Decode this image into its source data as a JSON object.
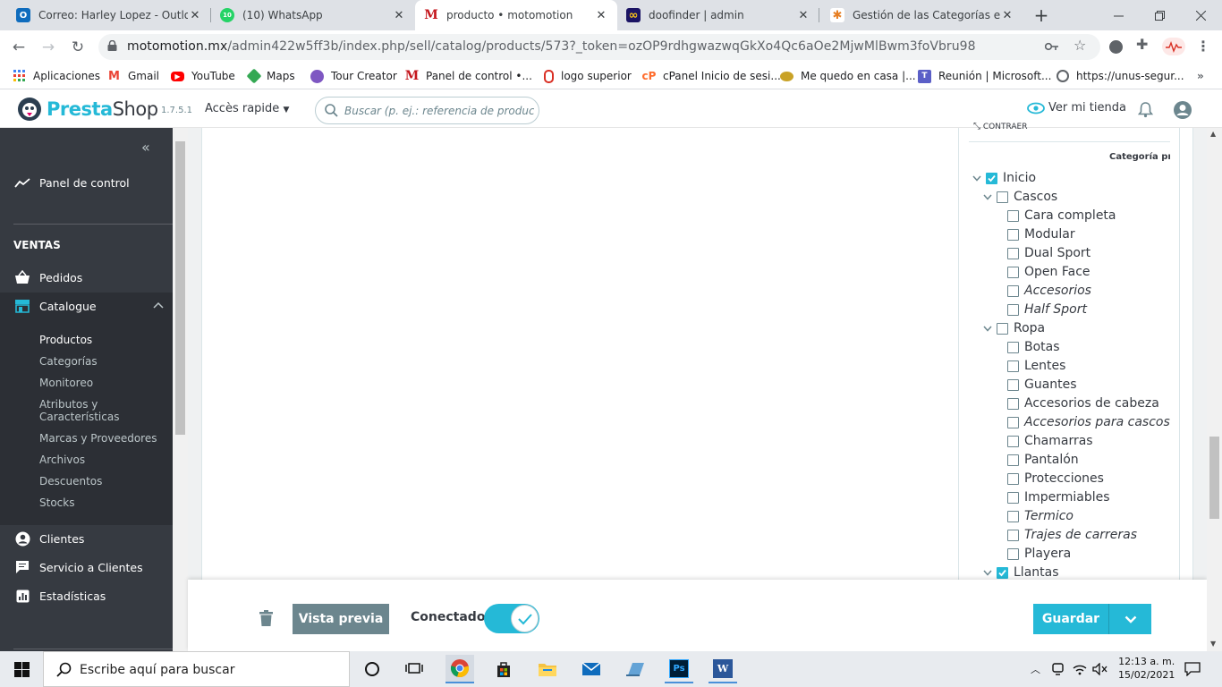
{
  "browser": {
    "tabs": [
      {
        "title": "Correo: Harley Lopez - Outlook",
        "favicon": "outlook-icon",
        "color": "#0f6cbd",
        "glyph": "O"
      },
      {
        "title": "(10) WhatsApp",
        "favicon": "whatsapp-icon",
        "color": "#25d366",
        "glyph": "10"
      },
      {
        "title": "producto • motomotion",
        "favicon": "motomotion-icon",
        "color": "#c4161c",
        "glyph": "M"
      },
      {
        "title": "doofinder | admin",
        "favicon": "doofinder-icon",
        "color": "#1b1464",
        "glyph": "∞"
      },
      {
        "title": "Gestión de las Categorías en P",
        "favicon": "prestashop-docs-icon",
        "color": "#e67e22",
        "glyph": "✱"
      }
    ],
    "new_tab": "+",
    "url_host": "motomotion.mx",
    "url_path": "/admin422w5ff3b/index.php/sell/catalog/products/573?_token=ozOP9rdhgwazwqGkXo4Qc6aOe2MjwMlBwm3foVbru98",
    "bookmarks": [
      {
        "label": "Aplicaciones",
        "icon": "apps-grid-icon",
        "color": "#4285f4"
      },
      {
        "label": "Gmail",
        "icon": "gmail-icon",
        "color": "#ea4335"
      },
      {
        "label": "YouTube",
        "icon": "youtube-icon",
        "color": "#ff0000"
      },
      {
        "label": "Maps",
        "icon": "maps-icon",
        "color": "#34a853"
      },
      {
        "label": "Tour Creator",
        "icon": "tour-creator-icon",
        "color": "#7e57c2"
      },
      {
        "label": "Panel de control •...",
        "icon": "motomotion-icon",
        "color": "#c4161c"
      },
      {
        "label": "logo superior",
        "icon": "logo-superior-icon",
        "color": "#d93025"
      },
      {
        "label": "cPanel Inicio de sesi...",
        "icon": "cpanel-icon",
        "color": "#ff6c2c"
      },
      {
        "label": "Me quedo en casa |...",
        "icon": "quedo-en-casa-icon",
        "color": "#c9a227"
      },
      {
        "label": "Reunión | Microsoft...",
        "icon": "teams-icon",
        "color": "#5b5fc7"
      },
      {
        "label": "https://unus-segur...",
        "icon": "globe-icon",
        "color": "#5f6368"
      }
    ]
  },
  "ps": {
    "brand_a": "Presta",
    "brand_b": "Shop",
    "version": "1.7.5.1",
    "quick_access": "Accès rapide",
    "search_placeholder": "Buscar (p. ej.: referencia de producto, nombre de cliente...)",
    "view_store": "Ver mi tienda",
    "accent": "#25b9d7"
  },
  "sidebar": {
    "dashboard": "Panel de control",
    "section": "VENTAS",
    "orders": "Pedidos",
    "catalogue": "Catalogue",
    "catalogue_items": [
      "Productos",
      "Categorías",
      "Monitoreo",
      "Atributos y Características",
      "Marcas y Proveedores",
      "Archivos",
      "Descuentos",
      "Stocks"
    ],
    "customers": "Clientes",
    "service": "Servicio a Clientes",
    "stats": "Estadísticas"
  },
  "categories": {
    "collapse_label": "CONTRAER",
    "main_category_header": "Categoría principal",
    "tree": [
      {
        "label": "Inicio",
        "level": 0,
        "checked": true,
        "expander": true,
        "italic": false
      },
      {
        "label": "Cascos",
        "level": 1,
        "checked": false,
        "expander": true,
        "italic": false
      },
      {
        "label": "Cara completa",
        "level": 2,
        "checked": false,
        "expander": false,
        "italic": false
      },
      {
        "label": "Modular",
        "level": 2,
        "checked": false,
        "expander": false,
        "italic": false
      },
      {
        "label": "Dual Sport",
        "level": 2,
        "checked": false,
        "expander": false,
        "italic": false
      },
      {
        "label": "Open Face",
        "level": 2,
        "checked": false,
        "expander": false,
        "italic": false
      },
      {
        "label": "Accesorios",
        "level": 2,
        "checked": false,
        "expander": false,
        "italic": true
      },
      {
        "label": "Half Sport",
        "level": 2,
        "checked": false,
        "expander": false,
        "italic": true
      },
      {
        "label": "Ropa",
        "level": 1,
        "checked": false,
        "expander": true,
        "italic": false
      },
      {
        "label": "Botas",
        "level": 2,
        "checked": false,
        "expander": false,
        "italic": false
      },
      {
        "label": "Lentes",
        "level": 2,
        "checked": false,
        "expander": false,
        "italic": false
      },
      {
        "label": "Guantes",
        "level": 2,
        "checked": false,
        "expander": false,
        "italic": false
      },
      {
        "label": "Accesorios de cabeza",
        "level": 2,
        "checked": false,
        "expander": false,
        "italic": false
      },
      {
        "label": "Accesorios para cascos",
        "level": 2,
        "checked": false,
        "expander": false,
        "italic": true
      },
      {
        "label": "Chamarras",
        "level": 2,
        "checked": false,
        "expander": false,
        "italic": false
      },
      {
        "label": "Pantalón",
        "level": 2,
        "checked": false,
        "expander": false,
        "italic": false
      },
      {
        "label": "Protecciones",
        "level": 2,
        "checked": false,
        "expander": false,
        "italic": false
      },
      {
        "label": "Impermiables",
        "level": 2,
        "checked": false,
        "expander": false,
        "italic": false
      },
      {
        "label": "Termico",
        "level": 2,
        "checked": false,
        "expander": false,
        "italic": true
      },
      {
        "label": "Trajes de carreras",
        "level": 2,
        "checked": false,
        "expander": false,
        "italic": true
      },
      {
        "label": "Playera",
        "level": 2,
        "checked": false,
        "expander": false,
        "italic": false
      },
      {
        "label": "Llantas",
        "level": 1,
        "checked": true,
        "expander": true,
        "italic": false
      }
    ]
  },
  "footer": {
    "preview": "Vista previa",
    "online_label": "Conectado",
    "online": true,
    "save": "Guardar"
  },
  "taskbar": {
    "search_placeholder": "Escribe aquí para buscar",
    "time": "12:13 a. m.",
    "date": "15/02/2021"
  }
}
